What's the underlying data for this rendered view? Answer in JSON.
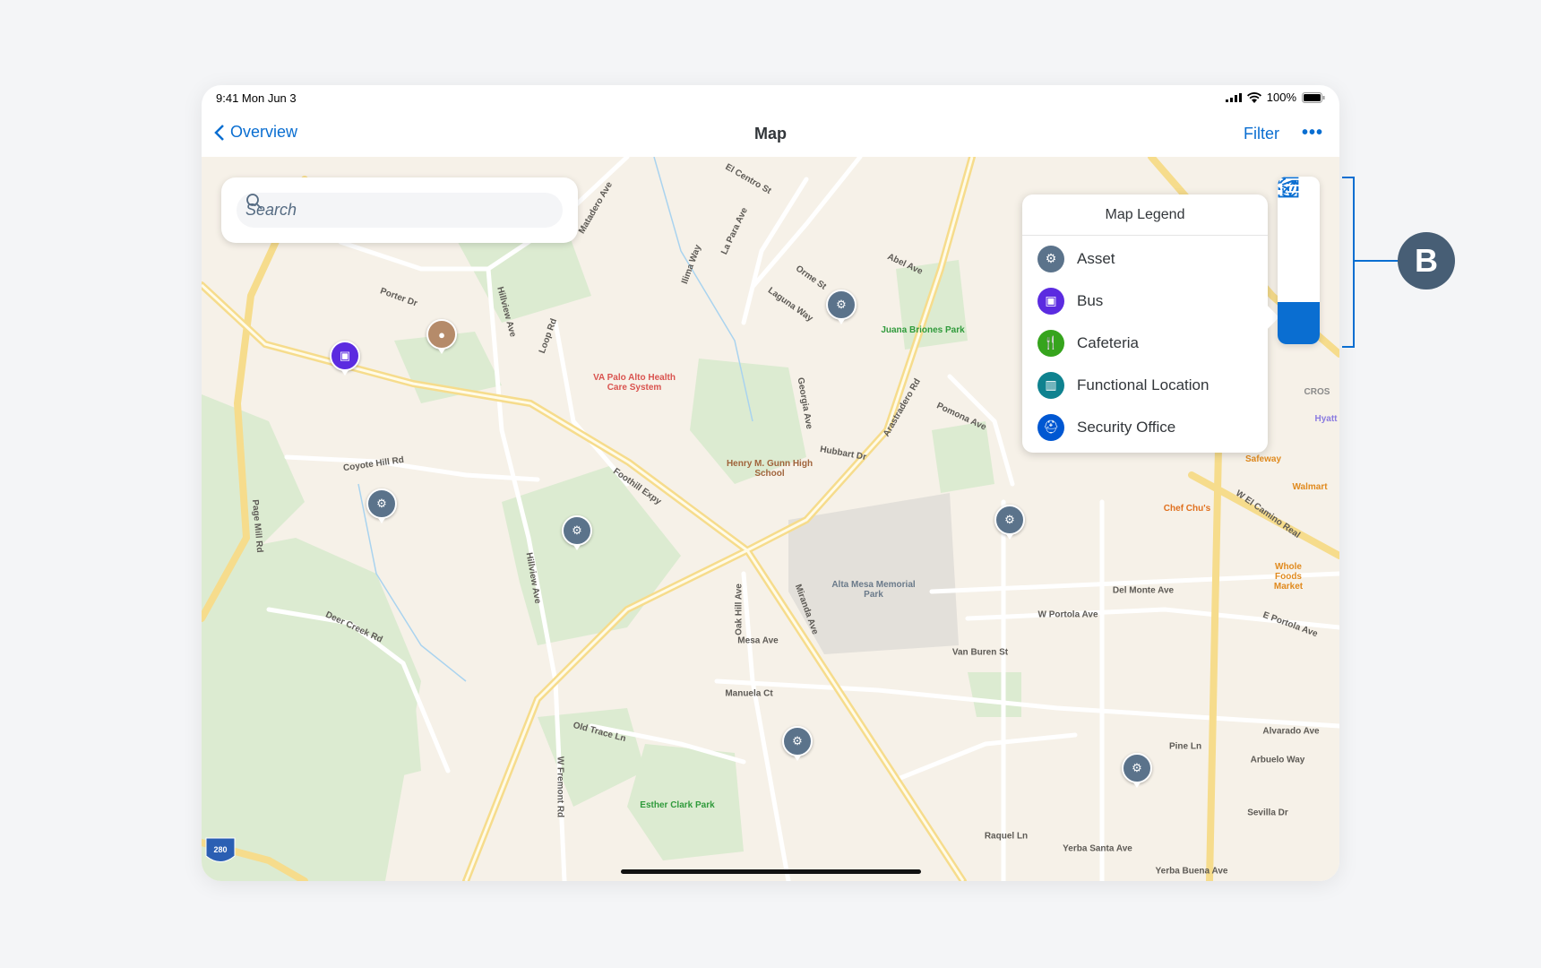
{
  "status_bar": {
    "time": "9:41  Mon Jun 3",
    "battery": "100%"
  },
  "nav": {
    "back_label": "Overview",
    "title": "Map",
    "filter_label": "Filter",
    "more_label": "•••"
  },
  "search": {
    "placeholder": "Search"
  },
  "legend": {
    "title": "Map Legend",
    "items": [
      {
        "label": "Asset",
        "icon": "robot-arm-icon",
        "color": "#5b738b"
      },
      {
        "label": "Bus",
        "icon": "bus-icon",
        "color": "#5b2be0"
      },
      {
        "label": "Cafeteria",
        "icon": "fork-knife-icon",
        "color": "#36a41d"
      },
      {
        "label": "Functional Location",
        "icon": "building-icon",
        "color": "#0f828f"
      },
      {
        "label": "Security Office",
        "icon": "police-cap-icon",
        "color": "#0057d2"
      }
    ]
  },
  "toolbar": {
    "buttons": [
      "info-icon",
      "location-arrow-icon",
      "expand-icon",
      "legend-list-icon"
    ],
    "active": "legend-list-icon",
    "accent": "#0a6ed1"
  },
  "annotation": {
    "badge": "B"
  },
  "map": {
    "streets": [
      "Foothill Expy",
      "Coyote Hill Rd",
      "Page Mill Rd",
      "Deer Creek Rd",
      "Hillview Ave",
      "Arastradero Rd",
      "Hubbart Dr",
      "Mesa Ave",
      "Manuela Ct",
      "Old Trace Ln",
      "W Fremont Rd",
      "Pine Ln",
      "W El Camino Real",
      "Del Monte Ave",
      "W Portola Ave",
      "Van Buren St",
      "Alvarado Ave",
      "Arbuelo Way",
      "Sevilla Dr",
      "Raquel Ln",
      "Yerba Santa Ave",
      "Porter Dr",
      "Loop Rd",
      "Georgia Ave",
      "Pomona Ave",
      "Miranda Ave",
      "Oak Hill Ave",
      "E Portola Ave",
      "Yerba Buena Ave",
      "Hillview Ave",
      "Orme St",
      "Laguna Way",
      "Abel Ave",
      "Matadero Ave",
      "El Centro St",
      "Ilima Way",
      "La Para Ave"
    ],
    "pois": [
      {
        "label": "Juana Briones Park",
        "color": "#2f9a3b"
      },
      {
        "label": "VA Palo Alto Health Care System",
        "color": "#d9534f"
      },
      {
        "label": "Henry M. Gunn High School",
        "color": "#a0643c"
      },
      {
        "label": "Alta Mesa Memorial Park",
        "color": "#6a7a8a"
      },
      {
        "label": "Esther Clark Park",
        "color": "#2f9a3b"
      },
      {
        "label": "Safeway",
        "color": "#e08a1e"
      },
      {
        "label": "Walmart",
        "color": "#e08a1e"
      },
      {
        "label": "Chef Chu's",
        "color": "#e0701e"
      },
      {
        "label": "Whole Foods Market",
        "color": "#e08a1e"
      },
      {
        "label": "Hyatt",
        "color": "#8a7be0"
      },
      {
        "label": "CROS",
        "color": "#8a8a8a"
      }
    ],
    "highway_shield": "280",
    "markers": {
      "asset_count": 6,
      "bus_count": 1,
      "user_avatar": 1
    }
  }
}
